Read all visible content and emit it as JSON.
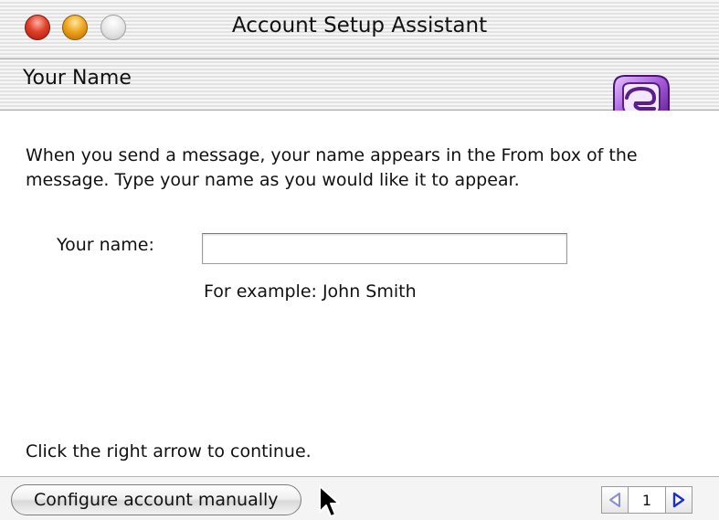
{
  "window": {
    "title": "Account Setup Assistant"
  },
  "header": {
    "step_title": "Your Name",
    "logo_icon": "entourage-mail-icon",
    "logo_color": "#9b46c9"
  },
  "content": {
    "intro": "When you send a message, your name appears in the From box of the message. Type your name as you would like it to appear.",
    "name_field": {
      "label": "Your name:",
      "value": "",
      "placeholder": ""
    },
    "example": "For example: John Smith",
    "continue_hint": "Click the right arrow to continue."
  },
  "footer": {
    "manual_button_label": "Configure account manually",
    "page_number": "1",
    "prev_icon": "left-arrow-icon",
    "next_icon": "right-arrow-icon",
    "prev_color": "#8a8fd0",
    "next_color": "#1a2fd8"
  }
}
